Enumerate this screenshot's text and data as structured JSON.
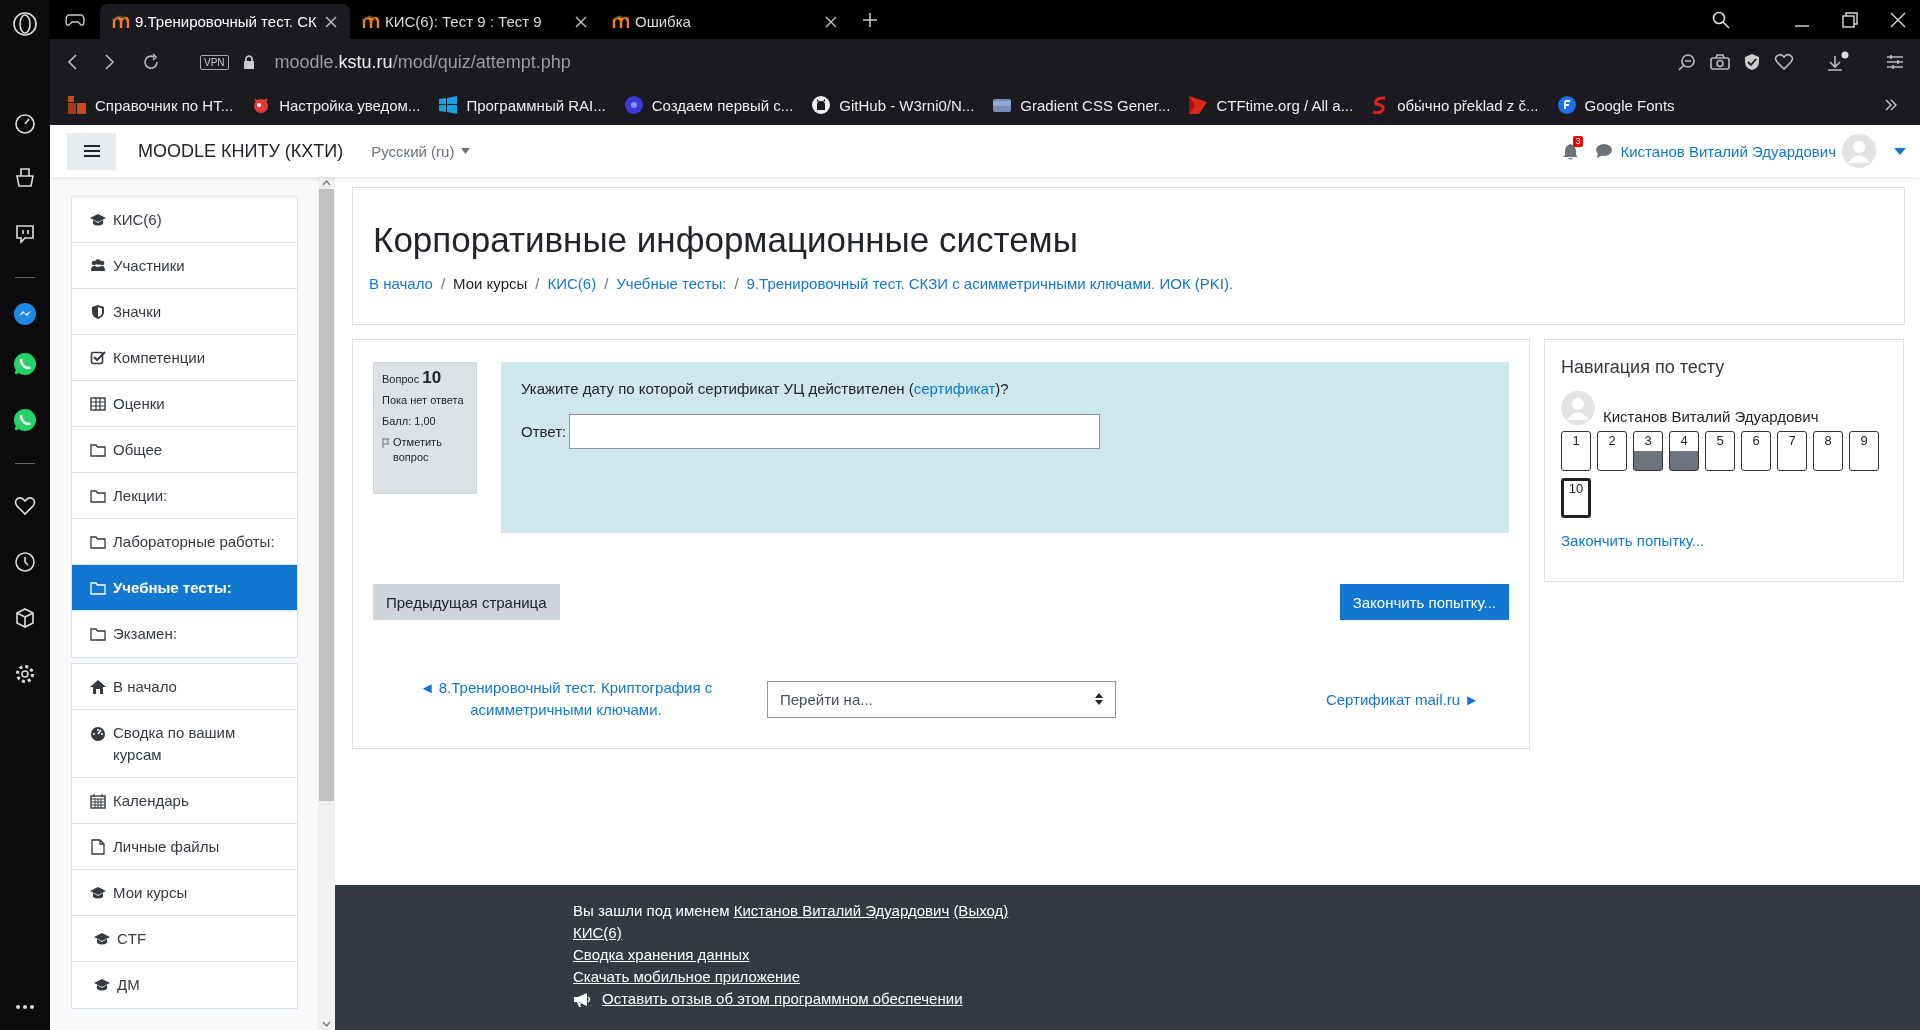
{
  "browser": {
    "tabs": [
      {
        "title": "9.Тренировочный тест. СК",
        "selected": true
      },
      {
        "title": "КИС(6): Тест 9 : Тест 9",
        "selected": false
      },
      {
        "title": "Ошибка",
        "selected": false
      }
    ],
    "vpn": "VPN",
    "url": [
      {
        "text": "moodle.",
        "highlight": false
      },
      {
        "text": "kstu.ru",
        "highlight": true
      },
      {
        "text": "/mod/quiz/attempt.php",
        "highlight": false
      }
    ],
    "bookmarks": [
      {
        "kind": "squares",
        "label": "Справочник по НТ..."
      },
      {
        "kind": "bug",
        "label": "Настройка уведом..."
      },
      {
        "kind": "windows",
        "label": "Программный RAI..."
      },
      {
        "kind": "circle",
        "label": "Создаем первый с..."
      },
      {
        "kind": "github",
        "label": "GitHub - W3rni0/N..."
      },
      {
        "kind": "folder",
        "label": "Gradient CSS Gener..."
      },
      {
        "kind": "flag",
        "label": "CTFtime.org / All a..."
      },
      {
        "kind": "swirl",
        "label": "обы́чно překlad z č..."
      },
      {
        "kind": "fonts",
        "label": "Google Fonts"
      }
    ]
  },
  "navbar": {
    "site_name": "MOODLE КНИТУ (КХТИ)",
    "language": "Русский (ru)",
    "notifications": "3",
    "user": "Кистанов Виталий Эдуардович"
  },
  "drawer": {
    "groups": [
      [
        {
          "kind": "course",
          "label": "КИС(6)",
          "selected": false
        },
        {
          "kind": "users",
          "label": "Участники",
          "selected": false
        },
        {
          "kind": "shield",
          "label": "Значки",
          "selected": false
        },
        {
          "kind": "check",
          "label": "Компетенции",
          "selected": false
        },
        {
          "kind": "table",
          "label": "Оценки",
          "selected": false
        },
        {
          "kind": "folder",
          "label": "Общее",
          "selected": false
        },
        {
          "kind": "folder",
          "label": "Лекции:",
          "selected": false
        },
        {
          "kind": "folder",
          "label": "Лабораторные работы:",
          "selected": false
        },
        {
          "kind": "folder",
          "label": "Учебные тесты:",
          "selected": true
        },
        {
          "kind": "folder",
          "label": "Экзамен:",
          "selected": false
        }
      ],
      [
        {
          "kind": "home",
          "label": "В начало",
          "selected": false
        },
        {
          "kind": "dashboard",
          "label": "Сводка по вашим курсам",
          "selected": false
        },
        {
          "kind": "calendar",
          "label": "Календарь",
          "selected": false
        },
        {
          "kind": "file",
          "label": "Личные файлы",
          "selected": false
        },
        {
          "kind": "course",
          "label": "Мои курсы",
          "selected": false,
          "children": [
            {
              "kind": "course",
              "label": "CTF",
              "selected": false
            },
            {
              "kind": "course",
              "label": "ДМ",
              "selected": false
            }
          ]
        }
      ]
    ]
  },
  "header": {
    "title": "Корпоративные информационные системы",
    "breadcrumb": [
      {
        "kind": "link",
        "text": "В начало"
      },
      {
        "kind": "separator",
        "text": "/"
      },
      {
        "kind": "text",
        "text": "Мои курсы"
      },
      {
        "kind": "separator",
        "text": "/"
      },
      {
        "kind": "link",
        "text": "КИС(6)"
      },
      {
        "kind": "separator",
        "text": "/"
      },
      {
        "kind": "link",
        "text": "Учебные тесты:"
      },
      {
        "kind": "separator",
        "text": "/"
      },
      {
        "kind": "link",
        "text": "9.Тренировочный тест. СКЗИ с асимметричными ключами. ИОК (PKI)."
      }
    ]
  },
  "question": {
    "label": "Вопрос",
    "number": "10",
    "state": "Пока нет ответа",
    "grade": "Балл: 1,00",
    "flag": "Отметить вопрос",
    "text": [
      {
        "text": "Укажите дату по которой сертификат УЦ действителен (",
        "link": false
      },
      {
        "text": "сертификат",
        "link": true
      },
      {
        "text": ")?",
        "link": false
      }
    ],
    "answer_label": "Ответ:"
  },
  "buttons": {
    "previous": "Предыдущая страница",
    "finish": "Закончить попытку..."
  },
  "activity_nav": {
    "previous": "◄ 8.Тренировочный тест. Криптография с асимметричными ключами.",
    "jump": "Перейти на...",
    "next": "Сертификат mail.ru ►"
  },
  "quiz_nav": {
    "title": "Навигация по тесту",
    "user": "Кистанов Виталий Эдуардович",
    "questions": [
      {
        "label": "1",
        "answered": false,
        "selected": false
      },
      {
        "label": "2",
        "answered": false,
        "selected": false
      },
      {
        "label": "3",
        "answered": true,
        "selected": false
      },
      {
        "label": "4",
        "answered": true,
        "selected": false
      },
      {
        "label": "5",
        "answered": false,
        "selected": false
      },
      {
        "label": "6",
        "answered": false,
        "selected": false
      },
      {
        "label": "7",
        "answered": false,
        "selected": false
      },
      {
        "label": "8",
        "answered": false,
        "selected": false
      },
      {
        "label": "9",
        "answered": false,
        "selected": false
      },
      {
        "label": "10",
        "answered": false,
        "selected": true
      }
    ],
    "finish": "Закончить попытку..."
  },
  "footer": {
    "login": {
      "text": "Вы зашли под именем ",
      "user": "Кистанов Виталий Эдуардович",
      "logout": "(Выход)"
    },
    "links": [
      "КИС(6)",
      "Сводка хранения данных",
      "Скачать мобильное приложение"
    ],
    "feedback": "Оставить отзыв об этом программном обеспечении"
  }
}
